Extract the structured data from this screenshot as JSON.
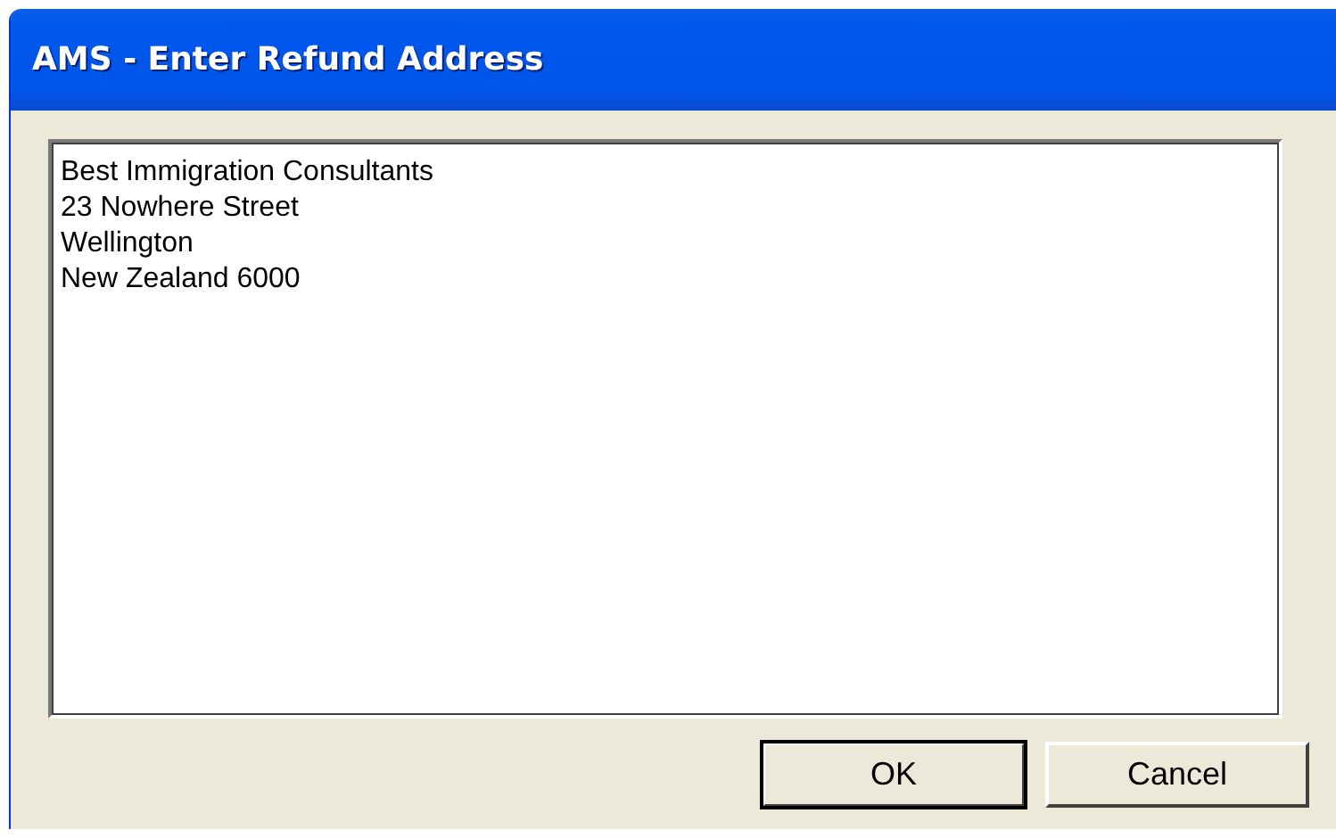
{
  "window": {
    "title": "AMS - Enter Refund Address"
  },
  "address_field": {
    "value": "Best Immigration Consultants\n23 Nowhere Street\nWellington\nNew Zealand 6000"
  },
  "buttons": [
    {
      "label": "OK",
      "default": true
    },
    {
      "label": "Cancel",
      "default": false
    }
  ]
}
